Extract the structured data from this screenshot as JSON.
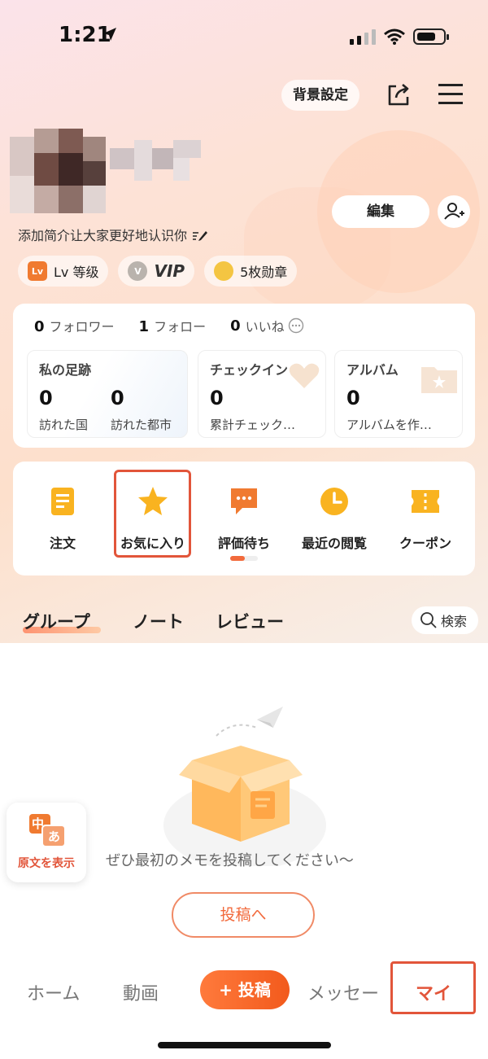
{
  "status_bar": {
    "time": "1:21"
  },
  "header": {
    "background_setting_label": "背景設定"
  },
  "profile": {
    "edit_label": "編集",
    "bio": "添加简介让大家更好地认识你",
    "badges": [
      {
        "icon": "Lv",
        "label": "Lv 等级"
      },
      {
        "icon": "V",
        "label": "VIP"
      },
      {
        "icon": "medal",
        "label": "5枚勋章"
      }
    ]
  },
  "stats": {
    "followers": {
      "count": "0",
      "label": "フォロワー"
    },
    "following": {
      "count": "1",
      "label": "フォロー"
    },
    "likes": {
      "count": "0",
      "label": "いいね"
    }
  },
  "tiles": {
    "footprint": {
      "title": "私の足跡",
      "countries_num": "0",
      "countries_label": "訪れた国",
      "cities_num": "0",
      "cities_label": "訪れた都市"
    },
    "checkin": {
      "title": "チェックイン",
      "num": "0",
      "label": "累計チェック…"
    },
    "album": {
      "title": "アルバム",
      "num": "0",
      "label": "アルバムを作…"
    }
  },
  "services": [
    {
      "icon": "order-icon",
      "label": "注文"
    },
    {
      "icon": "star-icon",
      "label": "お気に入り"
    },
    {
      "icon": "review-icon",
      "label": "評価待ち"
    },
    {
      "icon": "clock-icon",
      "label": "最近の閲覧"
    },
    {
      "icon": "coupon-icon",
      "label": "クーポン"
    }
  ],
  "content_tabs": {
    "group": "グループ",
    "note": "ノート",
    "review": "レビュー",
    "search": "検索"
  },
  "empty_state": {
    "message": "ぜひ最初のメモを投稿してください〜",
    "post_button": "投稿へ"
  },
  "translate": {
    "chars_zh": "中",
    "chars_ja": "あ",
    "label": "原文を表示"
  },
  "bottom_nav": {
    "home": "ホーム",
    "video": "動画",
    "post": "+ 投稿",
    "message": "メッセー",
    "mine": "マイ"
  },
  "colors": {
    "accent": "#f26a3c",
    "highlight_box": "#e2553a"
  }
}
